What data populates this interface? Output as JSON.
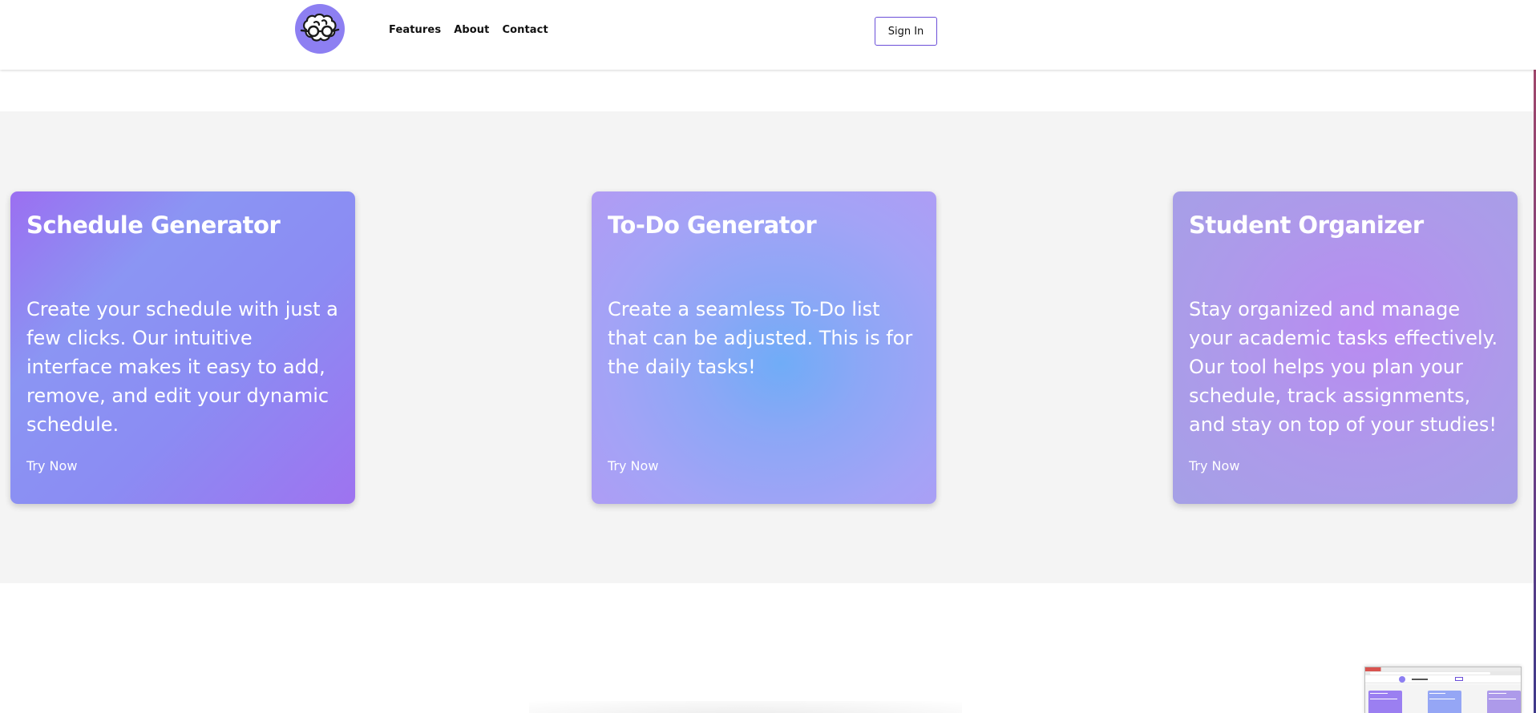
{
  "nav": {
    "logo_icon": "brain-logo-icon",
    "links": [
      "Features",
      "About",
      "Contact"
    ],
    "signin_label": "Sign In"
  },
  "colors": {
    "brand": "#8d7ff2",
    "signin_border": "#6b4fd8",
    "section_bg": "#f4f4f4"
  },
  "cards": [
    {
      "title": "Schedule Generator",
      "description": "Create your schedule with just a few clicks. Our intuitive interface makes it easy to add, remove, and edit your dynamic schedule.",
      "cta": "Try Now"
    },
    {
      "title": "To-Do Generator",
      "description": "Create a seamless To-Do list that can be adjusted. This is for the daily tasks!",
      "cta": "Try Now"
    },
    {
      "title": "Student Organizer",
      "description": "Stay organized and manage your academic tasks effectively. Our tool helps you plan your schedule, track assignments, and stay on top of your studies!",
      "cta": "Try Now"
    }
  ]
}
